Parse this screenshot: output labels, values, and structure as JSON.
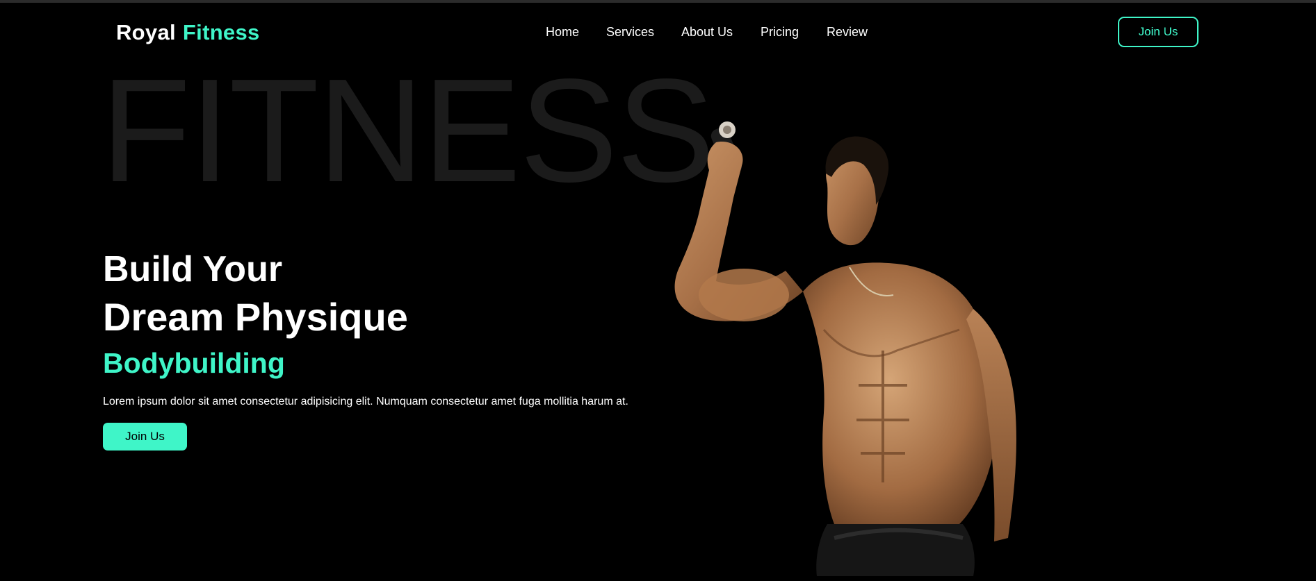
{
  "brand": {
    "name_part1": "Royal",
    "name_part2": "Fitness",
    "accent_color": "#3ff5c8"
  },
  "nav": {
    "items": [
      {
        "label": "Home"
      },
      {
        "label": "Services"
      },
      {
        "label": "About Us"
      },
      {
        "label": "Pricing"
      },
      {
        "label": "Review"
      }
    ],
    "cta_label": "Join Us"
  },
  "hero": {
    "background_word": "FITNESS",
    "title_line1": "Build Your",
    "title_line2": "Dream Physique",
    "subtitle": "Bodybuilding",
    "description": "Lorem ipsum dolor sit amet consectetur adipisicing elit. Numquam consectetur amet fuga mollitia harum at.",
    "cta_label": "Join Us",
    "image": "muscular-man-flexing-photo"
  }
}
